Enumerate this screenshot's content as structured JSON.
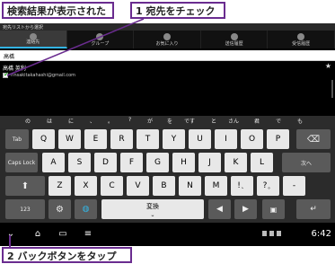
{
  "callouts": {
    "search_result": "検索結果が表示された",
    "step1": "1 宛先をチェック",
    "step2": "2 バックボタンをタップ"
  },
  "app": {
    "header_title": "宛先リストから選択",
    "tabs": [
      {
        "label": "連絡先",
        "icon": "person-icon"
      },
      {
        "label": "グループ",
        "icon": "group-icon"
      },
      {
        "label": "お気に入り",
        "icon": "star-icon"
      },
      {
        "label": "送信履歴",
        "icon": "history-icon"
      },
      {
        "label": "受信履歴",
        "icon": "inbox-icon"
      }
    ],
    "search_value": "高橋",
    "result": {
      "name": "高橋 英利",
      "email": "rinsakitakahashi@gmail.com",
      "checked": true
    }
  },
  "candidates": [
    "の",
    "は",
    "に",
    "、",
    "。",
    "?",
    "が",
    "を",
    "です",
    "と",
    "さん",
    "君",
    "で",
    "も"
  ],
  "keyboard": {
    "row1": [
      "Q",
      "W",
      "E",
      "R",
      "T",
      "Y",
      "U",
      "I",
      "O",
      "P"
    ],
    "row2": [
      "A",
      "S",
      "D",
      "F",
      "G",
      "H",
      "J",
      "K",
      "L"
    ],
    "row3": [
      "Z",
      "X",
      "C",
      "V",
      "B",
      "N",
      "M"
    ],
    "tab": "Tab",
    "capslock": "Caps Lock",
    "next": "次へ",
    "num": "123",
    "space": "変換",
    "exclaim": "!",
    "exclaim_sub": "、",
    "question": "?",
    "question_sub": "。",
    "dash": "-"
  },
  "navbar": {
    "clock": "6:42"
  }
}
